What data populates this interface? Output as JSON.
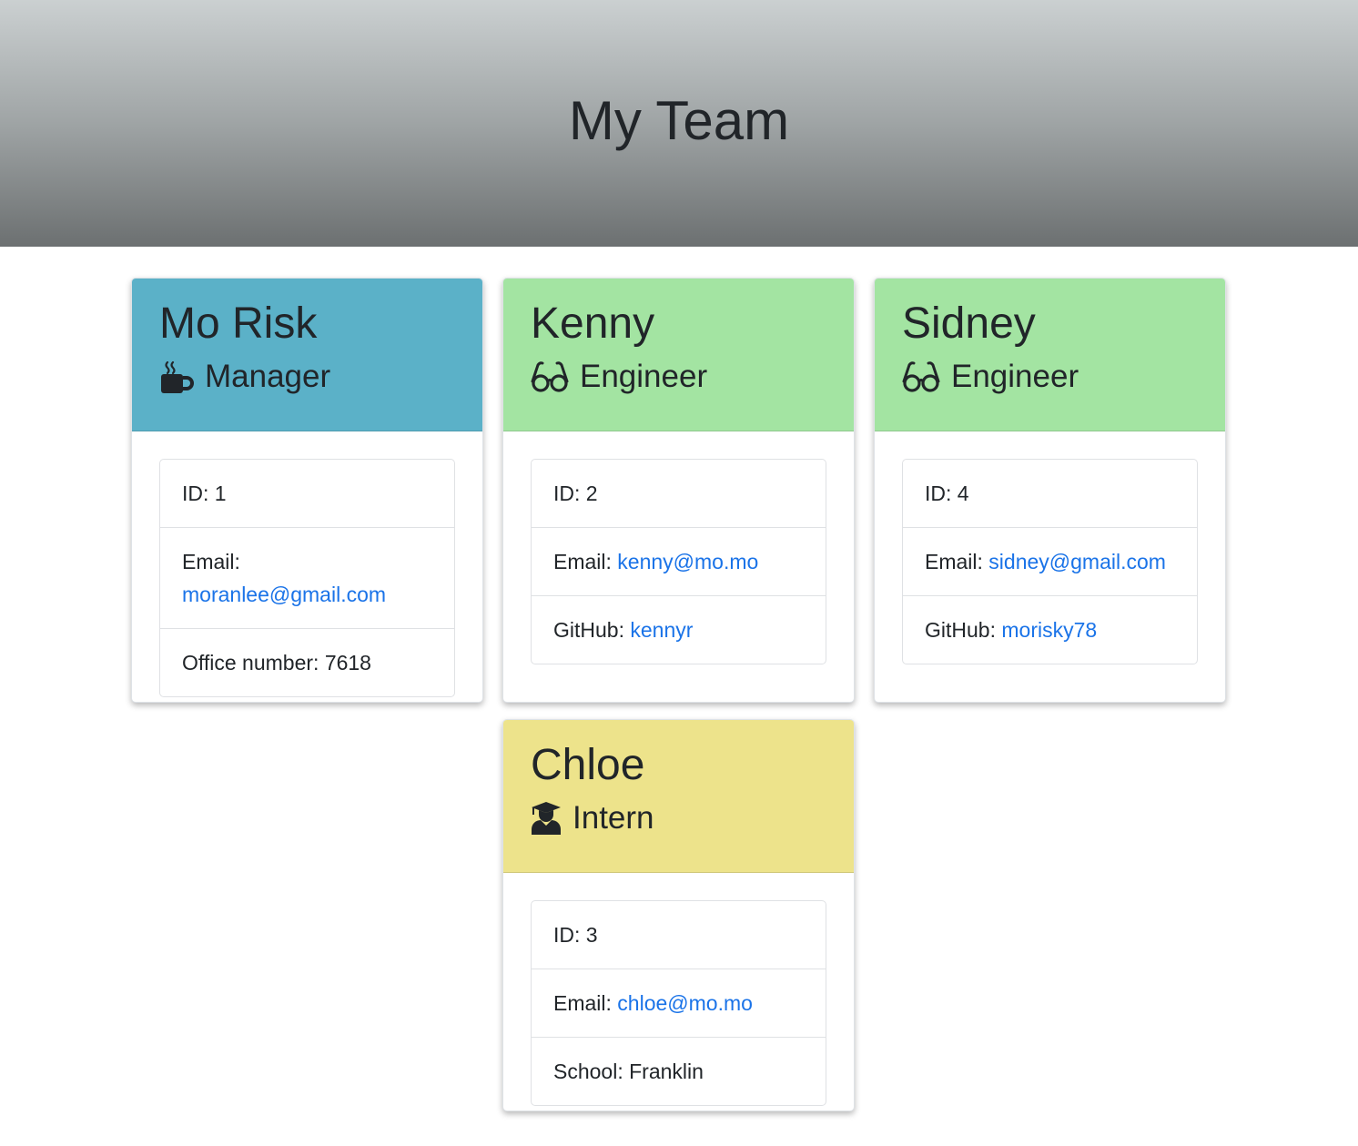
{
  "page": {
    "title": "My Team"
  },
  "colors": {
    "manager": "#5bb1c8",
    "engineer": "#a3e4a2",
    "intern": "#ede38b",
    "link": "#1a73e8"
  },
  "cards": [
    {
      "name": "Mo Risk",
      "role": "Manager",
      "icon": "mug-icon",
      "id_label": "ID:",
      "id": "1",
      "email_label": "Email:",
      "email": "moranlee@gmail.com",
      "extra_label": "Office number:",
      "extra": "7618"
    },
    {
      "name": "Kenny",
      "role": "Engineer",
      "icon": "glasses-icon",
      "id_label": "ID:",
      "id": "2",
      "email_label": "Email:",
      "email": "kenny@mo.mo",
      "extra_label": "GitHub:",
      "extra": "kennyr"
    },
    {
      "name": "Sidney",
      "role": "Engineer",
      "icon": "glasses-icon",
      "id_label": "ID:",
      "id": "4",
      "email_label": "Email:",
      "email": "sidney@gmail.com",
      "extra_label": "GitHub:",
      "extra": "morisky78"
    },
    {
      "name": "Chloe",
      "role": "Intern",
      "icon": "graduate-icon",
      "id_label": "ID:",
      "id": "3",
      "email_label": "Email:",
      "email": "chloe@mo.mo",
      "extra_label": "School:",
      "extra": "Franklin"
    }
  ]
}
